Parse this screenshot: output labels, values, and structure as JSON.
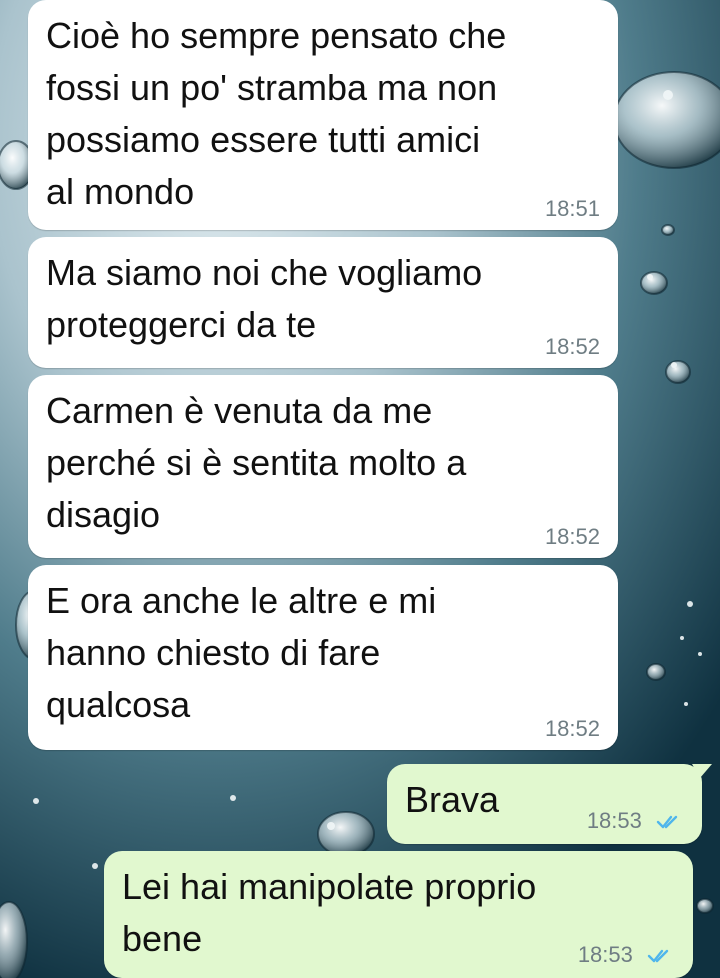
{
  "chat": {
    "messages": [
      {
        "direction": "incoming",
        "text": "Cioè ho sempre pensato che\nfossi un po' stramba ma non\npossiamo essere tutti amici\nal mondo",
        "time": "18:51"
      },
      {
        "direction": "incoming",
        "text": "Ma siamo noi che vogliamo\nproteggerci da te",
        "time": "18:52"
      },
      {
        "direction": "incoming",
        "text": "Carmen è venuta da me\nperché si è sentita molto a\ndisagio",
        "time": "18:52"
      },
      {
        "direction": "incoming",
        "text": "E ora anche le altre e mi\nhanno chiesto di fare\nqualcosa",
        "time": "18:52"
      },
      {
        "direction": "outgoing",
        "text": "Brava",
        "time": "18:53",
        "status": "read"
      },
      {
        "direction": "outgoing",
        "text": "Lei hai manipolate proprio\nbene",
        "time": "18:53",
        "status": "read"
      }
    ]
  },
  "colors": {
    "incoming_bubble": "#ffffff",
    "outgoing_bubble": "#e1f8cf",
    "timestamp": "#6f7d83",
    "read_ticks": "#4fb6ec"
  },
  "icons": {
    "read_receipt": "double-check-icon"
  }
}
